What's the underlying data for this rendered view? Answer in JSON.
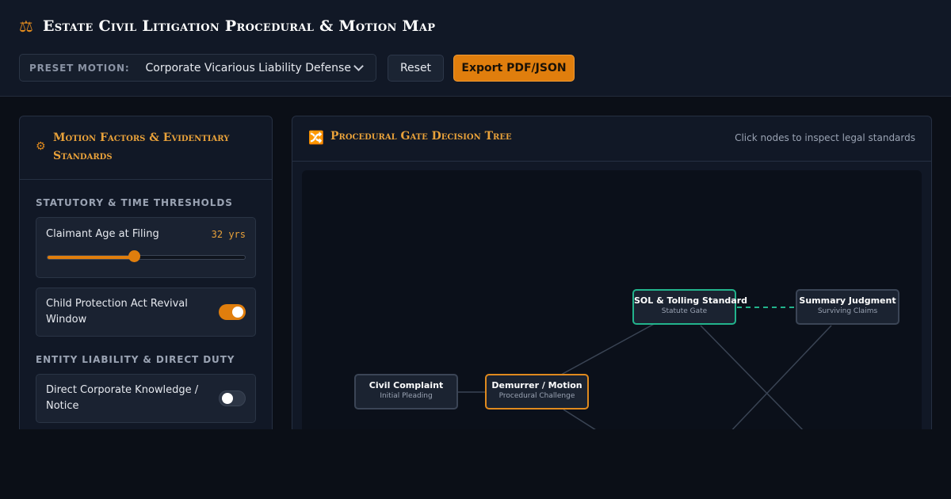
{
  "app": {
    "title": "Estate Civil Litigation Procedural & Motion Map",
    "icon": "scales-icon"
  },
  "toolbar": {
    "preset_label": "PRESET MOTION:",
    "preset_value": "Corporate Vicarious Liability Defense",
    "reset_label": "Reset",
    "export_label": "Export PDF/JSON"
  },
  "factors": {
    "title": "Motion Factors & Evidentiary Standards",
    "sections": {
      "statutory": "STATUTORY & TIME THRESHOLDS",
      "entity": "ENTITY LIABILITY & DIRECT DUTY"
    },
    "age": {
      "label": "Claimant Age at Filing",
      "value_text": "32 yrs",
      "fraction": 0.44
    },
    "revival": {
      "label": "Child Protection Act Revival Window",
      "on": true
    },
    "knowledge": {
      "label": "Direct Corporate Knowledge / Notice",
      "on": false
    }
  },
  "tree": {
    "title": "Procedural Gate Decision Tree",
    "hint": "Click nodes to inspect legal standards",
    "nodes": [
      {
        "title": "Civil Complaint",
        "sub": "Initial Pleading"
      },
      {
        "title": "Demurrer / Motion",
        "sub": "Procedural Challenge"
      },
      {
        "title": "SOL & Tolling Standard",
        "sub": "Statute Gate"
      },
      {
        "title": "Summary Judgment",
        "sub": "Surviving Claims"
      }
    ],
    "colors": {
      "accent": "#e08a1e",
      "active": "#22b38c",
      "edge": "#3a4454"
    }
  }
}
